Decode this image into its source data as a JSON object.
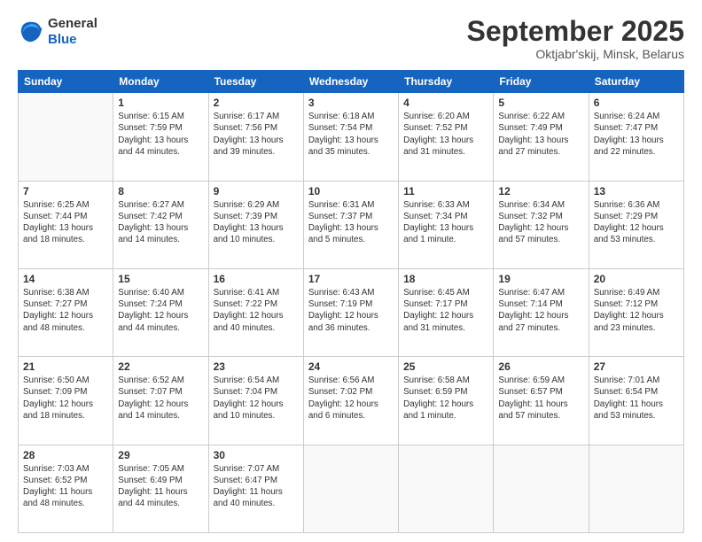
{
  "logo": {
    "line1": "General",
    "line2": "Blue"
  },
  "title": "September 2025",
  "subtitle": "Oktjabr'skij, Minsk, Belarus",
  "weekdays": [
    "Sunday",
    "Monday",
    "Tuesday",
    "Wednesday",
    "Thursday",
    "Friday",
    "Saturday"
  ],
  "weeks": [
    [
      {
        "day": "",
        "info": ""
      },
      {
        "day": "1",
        "info": "Sunrise: 6:15 AM\nSunset: 7:59 PM\nDaylight: 13 hours\nand 44 minutes."
      },
      {
        "day": "2",
        "info": "Sunrise: 6:17 AM\nSunset: 7:56 PM\nDaylight: 13 hours\nand 39 minutes."
      },
      {
        "day": "3",
        "info": "Sunrise: 6:18 AM\nSunset: 7:54 PM\nDaylight: 13 hours\nand 35 minutes."
      },
      {
        "day": "4",
        "info": "Sunrise: 6:20 AM\nSunset: 7:52 PM\nDaylight: 13 hours\nand 31 minutes."
      },
      {
        "day": "5",
        "info": "Sunrise: 6:22 AM\nSunset: 7:49 PM\nDaylight: 13 hours\nand 27 minutes."
      },
      {
        "day": "6",
        "info": "Sunrise: 6:24 AM\nSunset: 7:47 PM\nDaylight: 13 hours\nand 22 minutes."
      }
    ],
    [
      {
        "day": "7",
        "info": "Sunrise: 6:25 AM\nSunset: 7:44 PM\nDaylight: 13 hours\nand 18 minutes."
      },
      {
        "day": "8",
        "info": "Sunrise: 6:27 AM\nSunset: 7:42 PM\nDaylight: 13 hours\nand 14 minutes."
      },
      {
        "day": "9",
        "info": "Sunrise: 6:29 AM\nSunset: 7:39 PM\nDaylight: 13 hours\nand 10 minutes."
      },
      {
        "day": "10",
        "info": "Sunrise: 6:31 AM\nSunset: 7:37 PM\nDaylight: 13 hours\nand 5 minutes."
      },
      {
        "day": "11",
        "info": "Sunrise: 6:33 AM\nSunset: 7:34 PM\nDaylight: 13 hours\nand 1 minute."
      },
      {
        "day": "12",
        "info": "Sunrise: 6:34 AM\nSunset: 7:32 PM\nDaylight: 12 hours\nand 57 minutes."
      },
      {
        "day": "13",
        "info": "Sunrise: 6:36 AM\nSunset: 7:29 PM\nDaylight: 12 hours\nand 53 minutes."
      }
    ],
    [
      {
        "day": "14",
        "info": "Sunrise: 6:38 AM\nSunset: 7:27 PM\nDaylight: 12 hours\nand 48 minutes."
      },
      {
        "day": "15",
        "info": "Sunrise: 6:40 AM\nSunset: 7:24 PM\nDaylight: 12 hours\nand 44 minutes."
      },
      {
        "day": "16",
        "info": "Sunrise: 6:41 AM\nSunset: 7:22 PM\nDaylight: 12 hours\nand 40 minutes."
      },
      {
        "day": "17",
        "info": "Sunrise: 6:43 AM\nSunset: 7:19 PM\nDaylight: 12 hours\nand 36 minutes."
      },
      {
        "day": "18",
        "info": "Sunrise: 6:45 AM\nSunset: 7:17 PM\nDaylight: 12 hours\nand 31 minutes."
      },
      {
        "day": "19",
        "info": "Sunrise: 6:47 AM\nSunset: 7:14 PM\nDaylight: 12 hours\nand 27 minutes."
      },
      {
        "day": "20",
        "info": "Sunrise: 6:49 AM\nSunset: 7:12 PM\nDaylight: 12 hours\nand 23 minutes."
      }
    ],
    [
      {
        "day": "21",
        "info": "Sunrise: 6:50 AM\nSunset: 7:09 PM\nDaylight: 12 hours\nand 18 minutes."
      },
      {
        "day": "22",
        "info": "Sunrise: 6:52 AM\nSunset: 7:07 PM\nDaylight: 12 hours\nand 14 minutes."
      },
      {
        "day": "23",
        "info": "Sunrise: 6:54 AM\nSunset: 7:04 PM\nDaylight: 12 hours\nand 10 minutes."
      },
      {
        "day": "24",
        "info": "Sunrise: 6:56 AM\nSunset: 7:02 PM\nDaylight: 12 hours\nand 6 minutes."
      },
      {
        "day": "25",
        "info": "Sunrise: 6:58 AM\nSunset: 6:59 PM\nDaylight: 12 hours\nand 1 minute."
      },
      {
        "day": "26",
        "info": "Sunrise: 6:59 AM\nSunset: 6:57 PM\nDaylight: 11 hours\nand 57 minutes."
      },
      {
        "day": "27",
        "info": "Sunrise: 7:01 AM\nSunset: 6:54 PM\nDaylight: 11 hours\nand 53 minutes."
      }
    ],
    [
      {
        "day": "28",
        "info": "Sunrise: 7:03 AM\nSunset: 6:52 PM\nDaylight: 11 hours\nand 48 minutes."
      },
      {
        "day": "29",
        "info": "Sunrise: 7:05 AM\nSunset: 6:49 PM\nDaylight: 11 hours\nand 44 minutes."
      },
      {
        "day": "30",
        "info": "Sunrise: 7:07 AM\nSunset: 6:47 PM\nDaylight: 11 hours\nand 40 minutes."
      },
      {
        "day": "",
        "info": ""
      },
      {
        "day": "",
        "info": ""
      },
      {
        "day": "",
        "info": ""
      },
      {
        "day": "",
        "info": ""
      }
    ]
  ]
}
